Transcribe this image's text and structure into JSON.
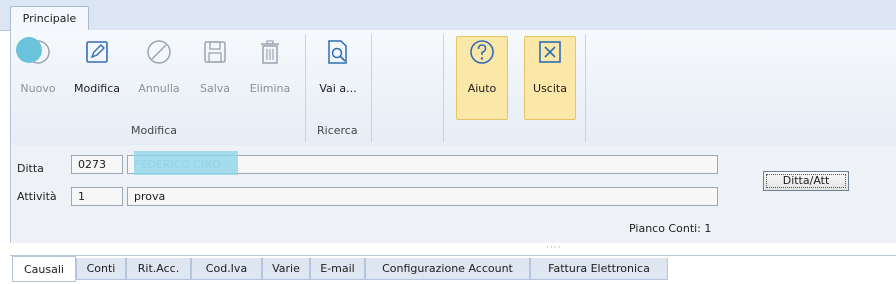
{
  "ribbon": {
    "tab_label": "Principale",
    "buttons": {
      "nuovo": "Nuovo",
      "modifica": "Modifica",
      "annulla": "Annulla",
      "salva": "Salva",
      "elimina": "Elimina",
      "vai": "Vai a...",
      "aiuto": "Aiuto",
      "uscita": "Uscita"
    },
    "groups": {
      "modifica": "Modifica",
      "ricerca": "Ricerca"
    }
  },
  "company": {
    "ditta_label": "Ditta",
    "ditta_code": "0273",
    "ditta_name": "FEDERICO CIRO",
    "attivita_label": "Attività",
    "attivita_code": "1",
    "attivita_name": "prova",
    "ditta_att_button": "Ditta/Att",
    "piano_conti": "Pianco Conti: 1",
    "splitter": "····"
  },
  "tabs": [
    "Causali",
    "Conti",
    "Rit.Acc.",
    "Cod.Iva",
    "Varie",
    "E-mail",
    "Configurazione Account",
    "Fattura Elettronica"
  ],
  "active_tab": "Causali",
  "colors": {
    "ribbon_bg": "#dce6f2",
    "highlight": "#fbe7a8",
    "icon_blue": "#2f6eb5"
  }
}
